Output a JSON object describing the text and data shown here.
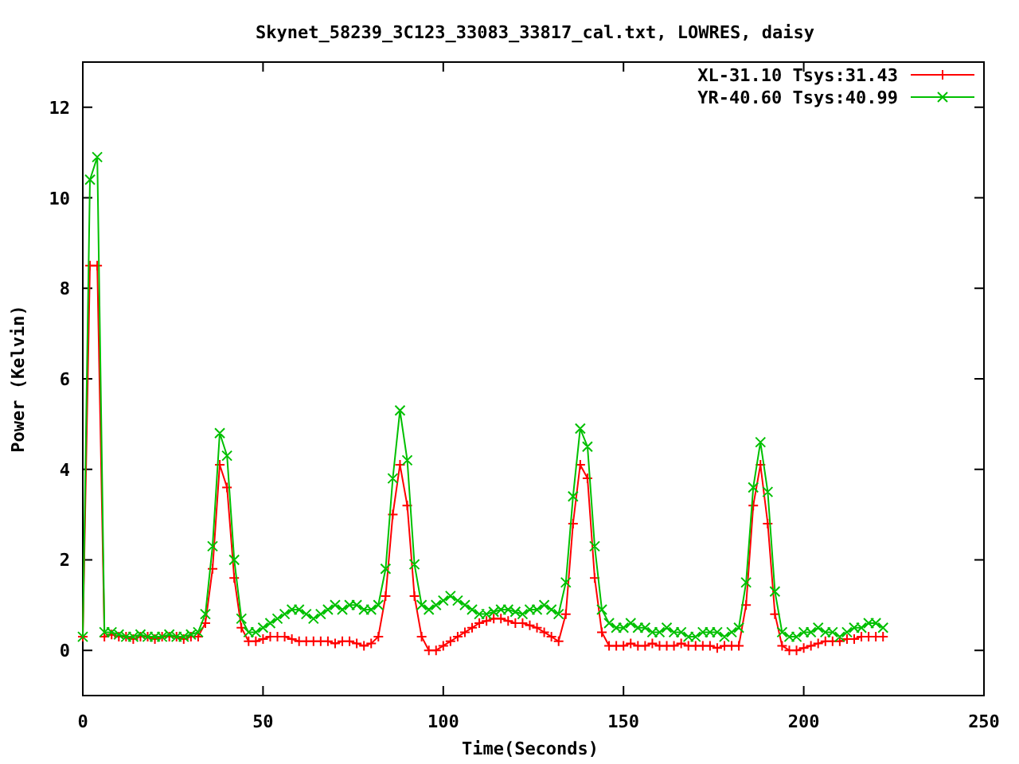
{
  "chart_data": {
    "type": "line",
    "title": "Skynet_58239_3C123_33083_33817_cal.txt, LOWRES, daisy",
    "xlabel": "Time(Seconds)",
    "ylabel": "Power (Kelvin)",
    "x": [
      0,
      2,
      4,
      6,
      8,
      10,
      12,
      14,
      16,
      18,
      20,
      22,
      24,
      26,
      28,
      30,
      32,
      34,
      36,
      38,
      40,
      42,
      44,
      46,
      48,
      50,
      52,
      54,
      56,
      58,
      60,
      62,
      64,
      66,
      68,
      70,
      72,
      74,
      76,
      78,
      80,
      82,
      84,
      86,
      88,
      90,
      92,
      94,
      96,
      98,
      100,
      102,
      104,
      106,
      108,
      110,
      112,
      114,
      116,
      118,
      120,
      122,
      124,
      126,
      128,
      130,
      132,
      134,
      136,
      138,
      140,
      142,
      144,
      146,
      148,
      150,
      152,
      154,
      156,
      158,
      160,
      162,
      164,
      166,
      168,
      170,
      172,
      174,
      176,
      178,
      180,
      182,
      184,
      186,
      188,
      190,
      192,
      194,
      196,
      198,
      200,
      202,
      204,
      206,
      208,
      210,
      212,
      214,
      216,
      218,
      220,
      222
    ],
    "series": [
      {
        "name": "XL-31.10 Tsys:31.43",
        "color": "#ff0000",
        "marker": "plus",
        "values": [
          0.3,
          8.5,
          8.5,
          0.3,
          0.35,
          0.3,
          0.3,
          0.25,
          0.3,
          0.3,
          0.25,
          0.3,
          0.3,
          0.3,
          0.25,
          0.3,
          0.3,
          0.6,
          1.8,
          4.1,
          3.6,
          1.6,
          0.5,
          0.2,
          0.2,
          0.25,
          0.3,
          0.3,
          0.3,
          0.25,
          0.2,
          0.2,
          0.2,
          0.2,
          0.2,
          0.15,
          0.2,
          0.2,
          0.15,
          0.1,
          0.15,
          0.3,
          1.2,
          3.0,
          4.1,
          3.2,
          1.2,
          0.3,
          0.0,
          0.0,
          0.1,
          0.2,
          0.3,
          0.4,
          0.5,
          0.6,
          0.65,
          0.7,
          0.7,
          0.65,
          0.6,
          0.6,
          0.55,
          0.5,
          0.4,
          0.3,
          0.2,
          0.8,
          2.8,
          4.1,
          3.8,
          1.6,
          0.4,
          0.1,
          0.1,
          0.1,
          0.15,
          0.1,
          0.1,
          0.15,
          0.1,
          0.1,
          0.1,
          0.15,
          0.1,
          0.1,
          0.1,
          0.1,
          0.05,
          0.1,
          0.1,
          0.1,
          1.0,
          3.2,
          4.1,
          2.8,
          0.8,
          0.1,
          0.0,
          0.0,
          0.05,
          0.1,
          0.15,
          0.2,
          0.2,
          0.2,
          0.25,
          0.25,
          0.3,
          0.3,
          0.3,
          0.3
        ]
      },
      {
        "name": "YR-40.60 Tsys:40.99",
        "color": "#00c000",
        "marker": "cross",
        "values": [
          0.3,
          10.4,
          10.9,
          0.4,
          0.4,
          0.35,
          0.3,
          0.3,
          0.35,
          0.3,
          0.3,
          0.3,
          0.35,
          0.3,
          0.3,
          0.35,
          0.4,
          0.8,
          2.3,
          4.8,
          4.3,
          2.0,
          0.7,
          0.4,
          0.4,
          0.5,
          0.6,
          0.7,
          0.8,
          0.9,
          0.9,
          0.8,
          0.7,
          0.8,
          0.9,
          1.0,
          0.9,
          1.0,
          1.0,
          0.9,
          0.9,
          1.0,
          1.8,
          3.8,
          5.3,
          4.2,
          1.9,
          1.0,
          0.9,
          1.0,
          1.1,
          1.2,
          1.1,
          1.0,
          0.9,
          0.8,
          0.8,
          0.85,
          0.9,
          0.9,
          0.85,
          0.8,
          0.9,
          0.9,
          1.0,
          0.9,
          0.8,
          1.5,
          3.4,
          4.9,
          4.5,
          2.3,
          0.9,
          0.6,
          0.5,
          0.5,
          0.6,
          0.5,
          0.5,
          0.4,
          0.4,
          0.5,
          0.4,
          0.4,
          0.3,
          0.3,
          0.4,
          0.4,
          0.4,
          0.3,
          0.4,
          0.5,
          1.5,
          3.6,
          4.6,
          3.5,
          1.3,
          0.4,
          0.3,
          0.3,
          0.4,
          0.4,
          0.5,
          0.4,
          0.4,
          0.3,
          0.4,
          0.5,
          0.5,
          0.6,
          0.6,
          0.5
        ]
      }
    ],
    "legend": true,
    "xlim": [
      0,
      250
    ],
    "ylim": [
      -1,
      13
    ],
    "xticks": [
      0,
      50,
      100,
      150,
      200,
      250
    ],
    "yticks": [
      0,
      2,
      4,
      6,
      8,
      10,
      12
    ]
  }
}
